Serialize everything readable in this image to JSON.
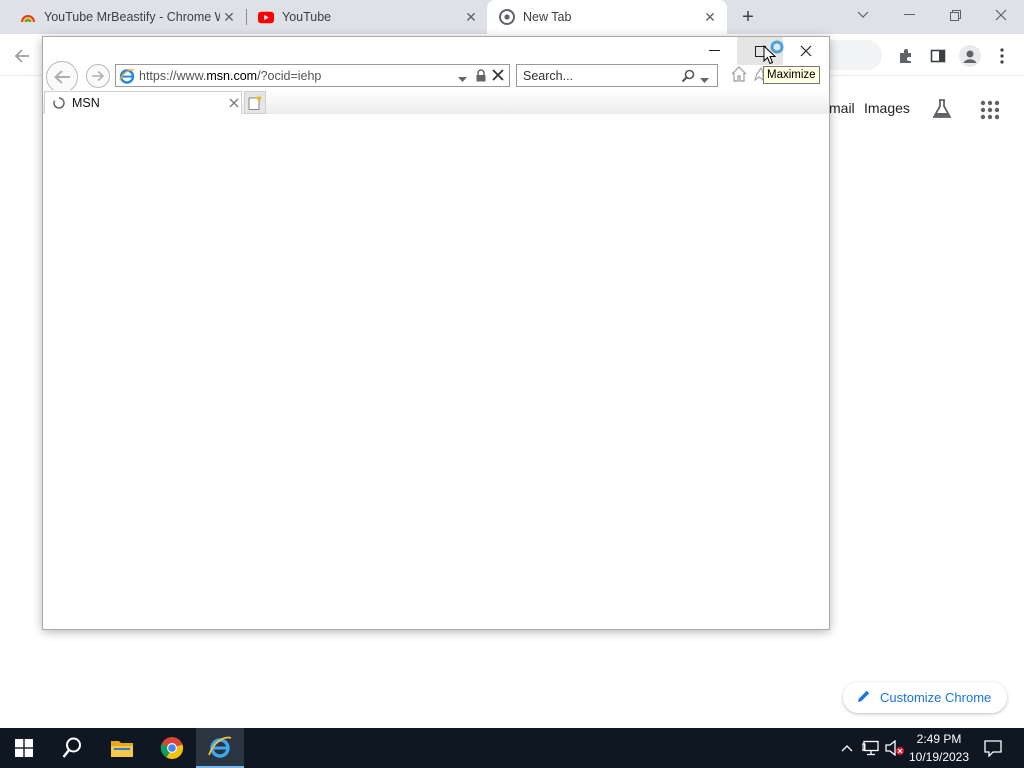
{
  "chrome": {
    "tabs": [
      {
        "title": "YouTube MrBeastify - Chrome W",
        "favicon": "rainbow-extension-icon",
        "active": false
      },
      {
        "title": "YouTube",
        "favicon": "youtube-icon",
        "active": false
      },
      {
        "title": "New Tab",
        "favicon": "chrome-icon",
        "active": true
      }
    ],
    "new_tab_symbol": "+",
    "google_links": {
      "gmail_partial": "mail",
      "images": "Images"
    },
    "customize_label": "Customize Chrome"
  },
  "ie": {
    "address": {
      "prefix": "https://www.",
      "host": "msn.com",
      "path": "/?ocid=iehp"
    },
    "search_placeholder": "Search...",
    "tab_title": "MSN",
    "tooltip": "Maximize"
  },
  "taskbar": {
    "time": "2:49 PM",
    "date": "10/19/2023"
  },
  "colors": {
    "chrome_tabstrip": "#dee1e6",
    "accent_blue": "#1a73e8",
    "taskbar": "#0f1722",
    "youtube_red": "#ff0000",
    "tooltip_bg": "#ffffe1"
  }
}
